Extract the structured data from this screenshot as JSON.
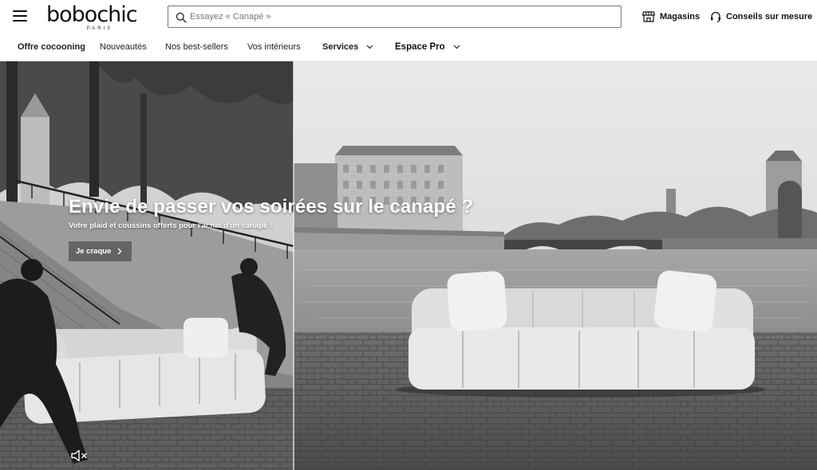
{
  "header": {
    "menu_icon": "hamburger-menu-icon",
    "logo": {
      "text": "bobochic",
      "subtext": "PARIS"
    },
    "search": {
      "placeholder": "Essayez « Canapé »",
      "value": "",
      "icon": "search-icon"
    },
    "stores": {
      "label": "Magasins",
      "icon": "store-icon"
    },
    "advice": {
      "label": "Conseils sur mesure",
      "icon": "headset-icon"
    }
  },
  "nav": {
    "items": [
      {
        "label": "Offre cocooning"
      },
      {
        "label": "Nouveautés"
      },
      {
        "label": "Nos best-sellers"
      },
      {
        "label": "Vos intérieurs"
      },
      {
        "label": "Services",
        "icon": "chevron-down-icon"
      },
      {
        "label": "Espace Pro",
        "icon": "chevron-down-icon"
      }
    ]
  },
  "hero": {
    "title": "Envie de passer vos soirées sur le canapé ?",
    "subtitle": "Votre plaid et coussins offerts pour l'achat d'un canapé !",
    "cta_label": "Je craque",
    "cta_icon": "chevron-right-icon",
    "mute_icon": "speaker-muted-icon"
  },
  "colors": {
    "text": "#111111",
    "border": "#777777",
    "cta_bg": "#5a5a5a"
  }
}
